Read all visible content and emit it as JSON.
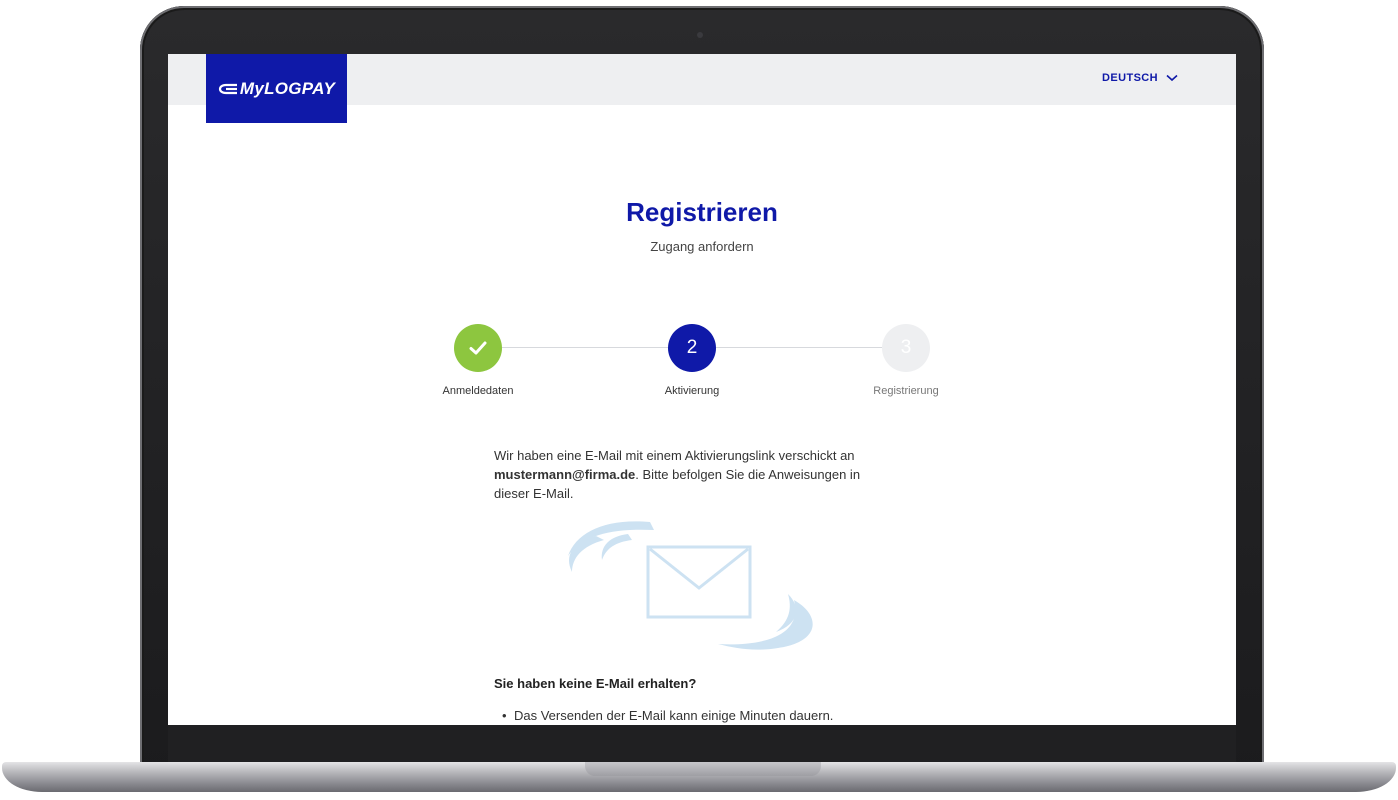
{
  "header": {
    "logo_text": "MyLOGPAY",
    "language": "DEUTSCH",
    "brand_color": "#0f19a8"
  },
  "page": {
    "title": "Registrieren",
    "subtitle": "Zugang anfordern"
  },
  "steps": [
    {
      "label": "Anmeldedaten",
      "number": "1",
      "state": "completed",
      "color": "#8dc63f",
      "icon": "check-icon"
    },
    {
      "label": "Aktivierung",
      "number": "2",
      "state": "active",
      "color": "#0f19a8"
    },
    {
      "label": "Registrierung",
      "number": "3",
      "state": "inactive",
      "color": "#eeeff1"
    }
  ],
  "message": {
    "before_email": "Wir haben eine E-Mail mit einem Aktivierungslink verschickt an",
    "email": "mustermann@firma.de",
    "after_email": ". Bitte befolgen Sie die Anweisungen in dieser E-Mail."
  },
  "illustration": {
    "icon": "envelope-icon",
    "color": "#cde2f2"
  },
  "help": {
    "heading": "Sie haben keine E-Mail erhalten?",
    "items": [
      "Das Versenden der E-Mail kann einige Minuten dauern."
    ]
  }
}
